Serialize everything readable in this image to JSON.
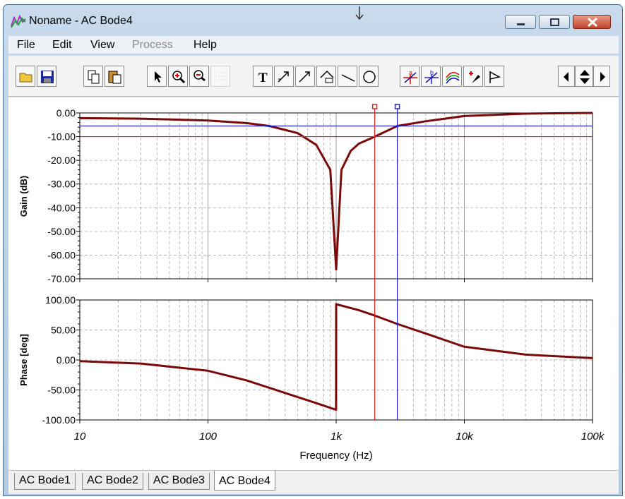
{
  "window": {
    "title": "Noname - AC Bode4",
    "icons": [
      "app-icon",
      "minimize-icon",
      "maximize-icon",
      "close-icon"
    ]
  },
  "menu": [
    "File",
    "Edit",
    "View",
    "Process",
    "Help"
  ],
  "menu_disabled": [
    "Process"
  ],
  "toolbar": {
    "icons": [
      "open-folder-icon",
      "save-icon",
      "copy-icon",
      "paste-icon",
      "pointer-icon",
      "zoom-in-icon",
      "zoom-100-icon",
      "grid-icon",
      "text-icon",
      "draw-arrow-icon",
      "draw-arrow-2-icon",
      "draw-box-icon",
      "line-icon",
      "circle-icon",
      "cursor-a-icon",
      "cursor-b-icon",
      "curves-icon",
      "pipette-icon",
      "flag-icon",
      "scroll-left-icon",
      "scroll-updown-icon",
      "scroll-right-icon"
    ],
    "text_button_label": "T"
  },
  "tabs": [
    "AC Bode1",
    "AC Bode2",
    "AC Bode3",
    "AC Bode4"
  ],
  "active_tab": "AC Bode4",
  "colors": {
    "curve": "#7a0a0a",
    "cursor_a": "#e02020",
    "cursor_b": "#2020d0",
    "grid": "#a8a8a8"
  },
  "chart_data": [
    {
      "type": "line",
      "ylabel": "Gain (dB)",
      "ylim": [
        -70,
        0
      ],
      "yticks": [
        "0.00",
        "-10.00",
        "-20.00",
        "-30.00",
        "-40.00",
        "-50.00",
        "-60.00",
        "-70.00"
      ],
      "xscale": "log",
      "xlim": [
        10,
        100000
      ],
      "grid": true,
      "x": [
        10,
        30,
        100,
        200,
        300,
        500,
        700,
        900,
        1000,
        1100,
        1300,
        1500,
        2000,
        3000,
        5000,
        10000,
        30000,
        100000
      ],
      "y": [
        -2.2,
        -2.4,
        -3.2,
        -4.3,
        -5.5,
        -8.5,
        -13.5,
        -24,
        -66,
        -24,
        -16,
        -13,
        -10,
        -5.5,
        -3.5,
        -1.3,
        -0.3,
        0
      ],
      "cursors": [
        {
          "name": "a",
          "x": 2000,
          "y": -10
        },
        {
          "name": "b",
          "x": 3000,
          "y": -5.5
        }
      ]
    },
    {
      "type": "line",
      "xlabel": "Frequency (Hz)",
      "ylabel": "Phase [deg]",
      "ylim": [
        -100,
        100
      ],
      "yticks": [
        "100.00",
        "50.00",
        "0.00",
        "-50.00",
        "-100.00"
      ],
      "xscale": "log",
      "xlim": [
        10,
        100000
      ],
      "xticks": [
        "10",
        "100",
        "1k",
        "10k",
        "100k"
      ],
      "grid": true,
      "x": [
        10,
        30,
        100,
        200,
        400,
        700,
        999,
        1000,
        1500,
        2000,
        3000,
        5000,
        10000,
        30000,
        100000
      ],
      "y": [
        -2,
        -6,
        -18,
        -34,
        -55,
        -72,
        -83,
        93,
        83,
        74,
        60,
        44,
        22,
        9,
        3
      ]
    }
  ]
}
